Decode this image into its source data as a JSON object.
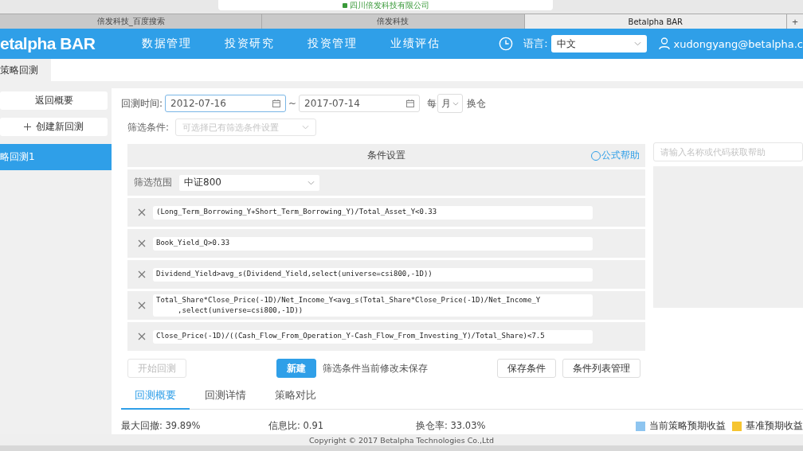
{
  "browser": {
    "address": "四川倍发科技有限公司",
    "tabs": [
      {
        "label": "倍发科技_百度搜索",
        "selected": false
      },
      {
        "label": "倍发科技",
        "selected": false
      },
      {
        "label": "Betalpha BAR",
        "selected": true
      }
    ],
    "new_tab": "+"
  },
  "nav": {
    "logo": "etalpha BAR",
    "menu": [
      "数据管理",
      "投资研究",
      "投资管理",
      "业绩评估"
    ],
    "language_label": "语言:",
    "language": "中文",
    "user": "xudongyang@betalpha.c"
  },
  "page_tab": "策略回测",
  "sidebar": {
    "buttons": [
      "返回概要",
      "创建新回测"
    ],
    "items": [
      {
        "label": "略回测1",
        "selected": true
      }
    ]
  },
  "form": {
    "time_label": "回测时间:",
    "start": "2012-07-16",
    "tilde": "~",
    "end": "2017-07-14",
    "every": "每",
    "period": "月",
    "rebalance": "换仓",
    "filter_label": "筛选条件:",
    "filter_placeholder": "可选择已有筛选条件设置"
  },
  "conditions": {
    "title": "条件设置",
    "help": "公式帮助",
    "range_label": "筛选范围",
    "range": "中证800",
    "formulas": [
      "(Long_Term_Borrowing_Y+Short_Term_Borrowing_Y)/Total_Asset_Y<0.33",
      "Book_Yield_Q>0.33",
      "Dividend_Yield>avg_s(Dividend_Yield,select(universe=csi800,-1D))",
      "Total_Share*Close_Price(-1D)/Net_Income_Y<avg_s(Total_Share*Close_Price(-1D)/Net_Income_Y\n     ,select(universe=csi800,-1D))",
      "Close_Price(-1D)/((Cash_Flow_From_Operation_Y-Cash_Flow_From_Investing_Y)/Total_Share)<7.5"
    ]
  },
  "help_search": {
    "placeholder": "请输入名称或代码获取帮助"
  },
  "actions": {
    "start": {
      "label": "开始回测",
      "disabled": true
    },
    "new": "新建",
    "notice": "筛选条件当前修改未保存",
    "save": "保存条件",
    "manage": "条件列表管理"
  },
  "result_tabs": [
    {
      "label": "回测概要",
      "selected": true
    },
    {
      "label": "回测详情",
      "selected": false
    },
    {
      "label": "策略对比",
      "selected": false
    }
  ],
  "stats": [
    "最大回撤: 39.89%",
    "信息比: 0.91",
    "换仓率: 33.03%"
  ],
  "legend": [
    {
      "label": "当前策略预期收益",
      "color": "#8ec5f0"
    },
    {
      "label": "基准预期收益",
      "color": "#f6c531"
    }
  ],
  "footer": "Copyright © 2017 Betalpha Technologies Co.,Ltd"
}
